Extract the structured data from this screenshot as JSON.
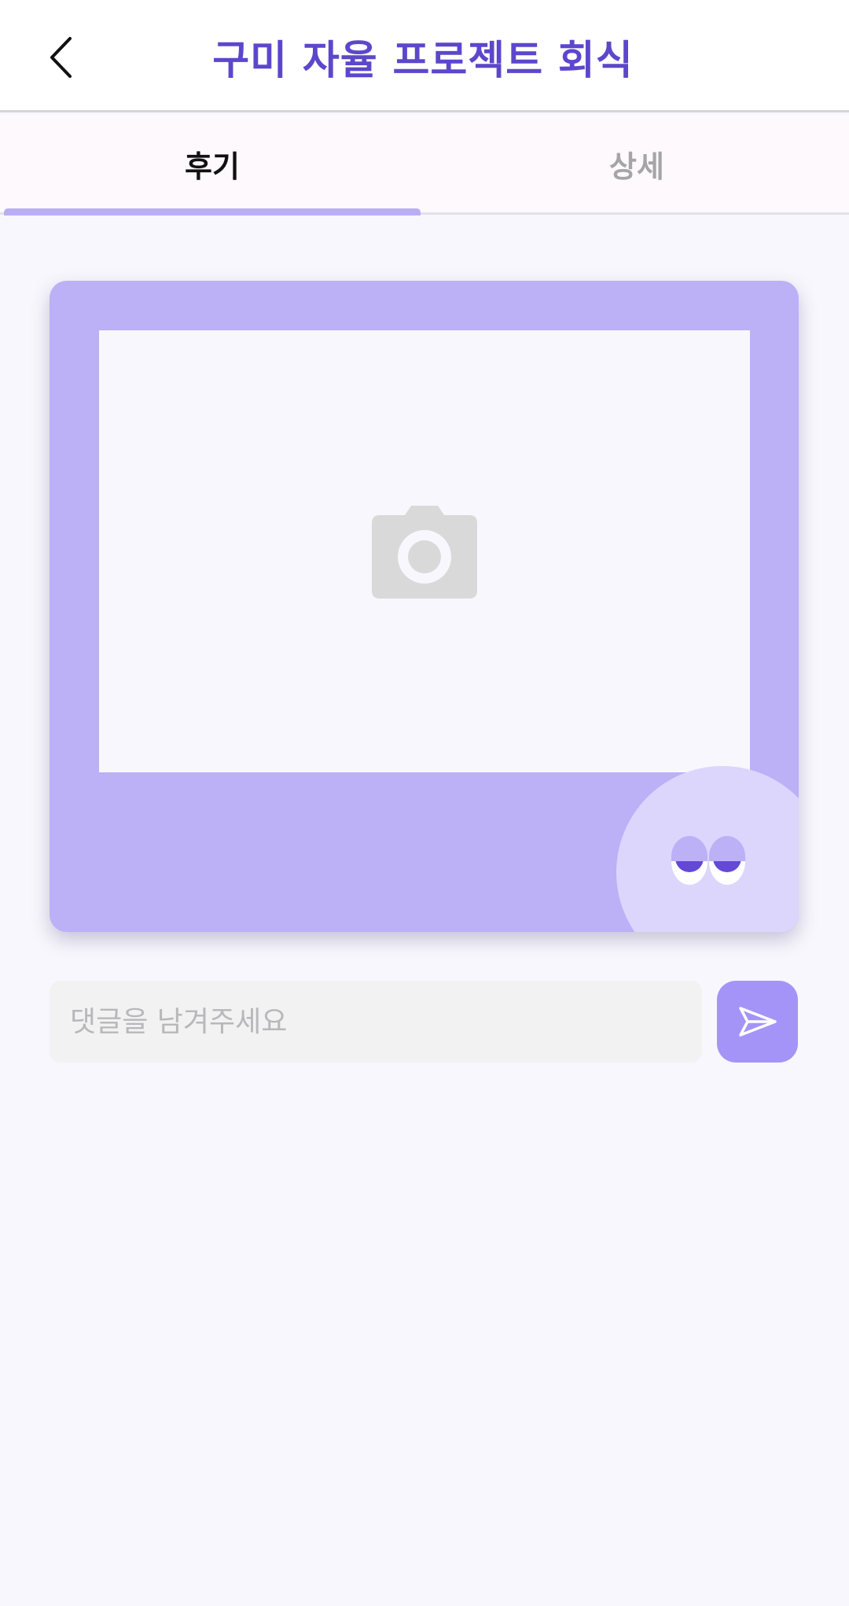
{
  "header": {
    "title": "구미 자율 프로젝트 회식",
    "back_icon": "chevron-left-icon"
  },
  "tabs": [
    {
      "label": "후기",
      "active": true
    },
    {
      "label": "상세",
      "active": false
    }
  ],
  "card": {
    "photo_icon": "camera-icon",
    "mascot": "peeking-mascot"
  },
  "comment": {
    "placeholder": "댓글을 남겨주세요",
    "value": "",
    "send_icon": "send-icon"
  },
  "colors": {
    "accent": "#5c47cc",
    "card": "#bcb0f7",
    "send_button": "#a594f7",
    "tab_indicator": "#b9aef5"
  }
}
